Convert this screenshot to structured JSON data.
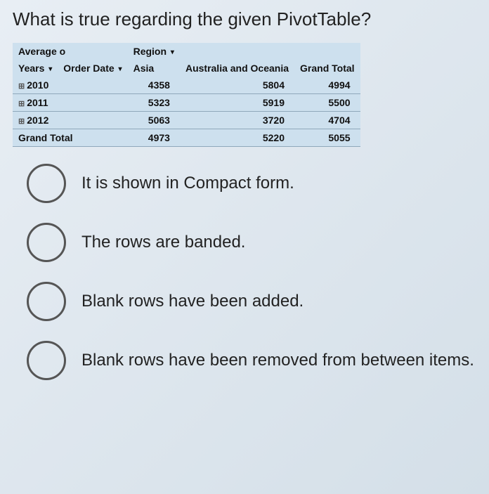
{
  "question": "What is true regarding the given PivotTable?",
  "pivot": {
    "corner": "Average o",
    "region_label": "Region",
    "row_field1": "Years",
    "row_field2": "Order Date",
    "col_asia": "Asia",
    "col_aus": "Australia and Oceania",
    "col_gt": "Grand Total",
    "rows": [
      {
        "label": "2010",
        "asia": "4358",
        "aus": "5804",
        "gt": "4994"
      },
      {
        "label": "2011",
        "asia": "5323",
        "aus": "5919",
        "gt": "5500"
      },
      {
        "label": "2012",
        "asia": "5063",
        "aus": "3720",
        "gt": "4704"
      }
    ],
    "grand": {
      "label": "Grand Total",
      "asia": "4973",
      "aus": "5220",
      "gt": "5055"
    }
  },
  "options": [
    "It is shown in Compact form.",
    "The rows are banded.",
    "Blank rows have been added.",
    "Blank rows have been removed from between items."
  ],
  "chart_data": {
    "type": "table",
    "title": "Average o by Years/Order Date and Region",
    "columns": [
      "Years",
      "Asia",
      "Australia and Oceania",
      "Grand Total"
    ],
    "rows": [
      [
        "2010",
        4358,
        5804,
        4994
      ],
      [
        "2011",
        5323,
        5919,
        5500
      ],
      [
        "2012",
        5063,
        3720,
        4704
      ],
      [
        "Grand Total",
        4973,
        5220,
        5055
      ]
    ]
  }
}
